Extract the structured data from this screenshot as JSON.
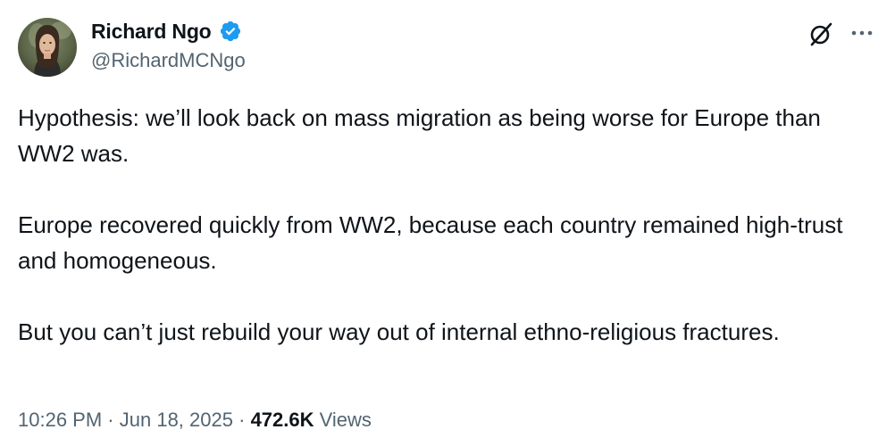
{
  "author": {
    "display_name": "Richard Ngo",
    "handle": "@RichardMCNgo",
    "verified": true,
    "verified_badge_color": "#1d9bf0"
  },
  "header_actions": {
    "grok_icon": "grok-icon",
    "more_icon": "more-options-icon"
  },
  "tweet": {
    "paragraphs": [
      "Hypothesis: we’ll look back on mass migration as being worse for Europe than WW2 was.",
      "Europe recovered quickly from WW2, because each country remained high-trust and homogeneous.",
      "But you can’t just rebuild your way out of internal ethno-religious fractures."
    ]
  },
  "meta": {
    "time": "10:26 PM",
    "separator": "·",
    "date": "Jun 18, 2025",
    "views_count": "472.6K",
    "views_label": "Views"
  },
  "colors": {
    "text_primary": "#0f1419",
    "text_secondary": "#536471",
    "accent": "#1d9bf0"
  }
}
